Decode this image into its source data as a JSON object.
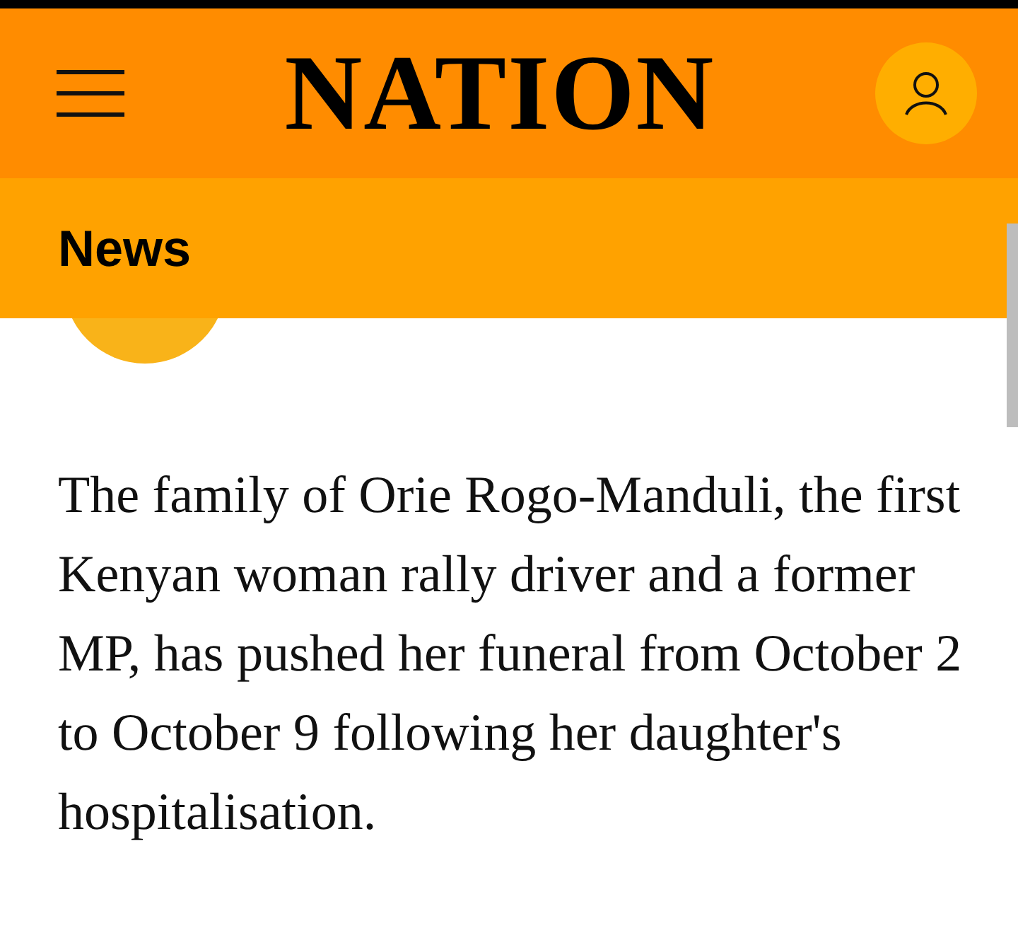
{
  "header": {
    "logo": "NATION"
  },
  "section_bar": {
    "title": "News"
  },
  "article": {
    "paragraph": "The family of Orie Rogo-Manduli, the first Kenyan woman rally driver and a former MP, has pushed her funeral from October 2 to October 9 following her daughter's hospitalisation."
  }
}
